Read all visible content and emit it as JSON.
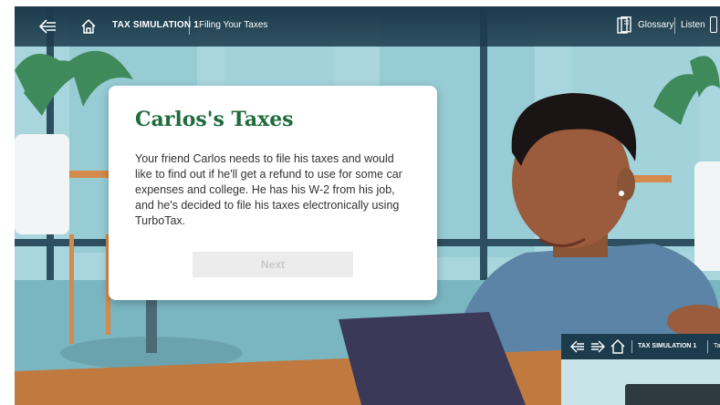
{
  "topbar": {
    "section": "TAX SIMULATION 1",
    "page": "Filing Your Taxes",
    "glossary_label": "Glossary",
    "listen_label": "Listen"
  },
  "card": {
    "title": "Carlos's Taxes",
    "body": "Your friend Carlos needs to file his taxes and would like to find out if he'll get a refund to use for some car expenses and college. He has his W-2 from his job, and he's decided to file his taxes electronically using TurboTax.",
    "next_label": "Next"
  },
  "mini_preview": {
    "section": "TAX SIMULATION 1",
    "page_fragment": "Ta"
  },
  "colors": {
    "topbar": "#1c3b4c",
    "title": "#1f6b3c",
    "sky": "#b7dfe6"
  },
  "icons": [
    "back-arrow-icon",
    "home-icon",
    "glossary-book-icon",
    "listen-icon",
    "forward-arrow-icon"
  ]
}
